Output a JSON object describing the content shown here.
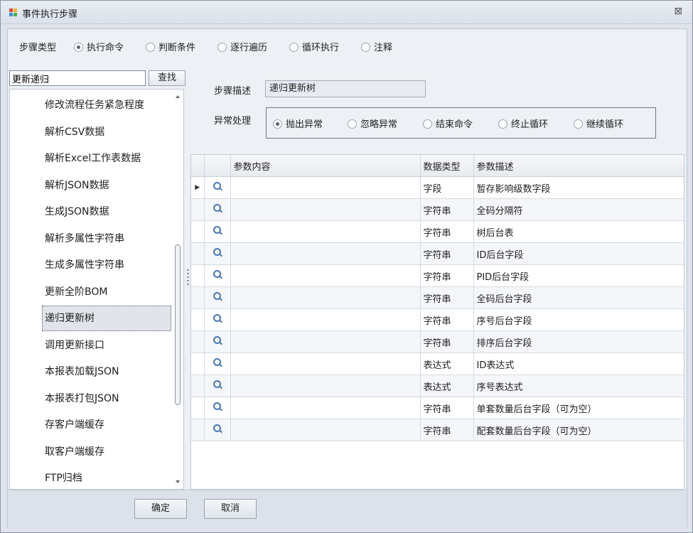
{
  "window": {
    "title": "事件执行步骤",
    "close_glyph": "⊠"
  },
  "step_type": {
    "label": "步骤类型",
    "options": [
      "执行命令",
      "判断条件",
      "逐行遍历",
      "循环执行",
      "注释"
    ],
    "selected": "执行命令"
  },
  "search": {
    "value": "更新递归",
    "button_label": "查找"
  },
  "commands": {
    "items": [
      "修改流程任务紧急程度",
      "解析CSV数据",
      "解析Excel工作表数据",
      "解析JSON数据",
      "生成JSON数据",
      "解析多属性字符串",
      "生成多属性字符串",
      "更新全阶BOM",
      "递归更新树",
      "调用更新接口",
      "本报表加载JSON",
      "本报表打包JSON",
      "存客户端缓存",
      "取客户端缓存",
      "FTP归档"
    ],
    "selected": "递归更新树"
  },
  "step_desc": {
    "label": "步骤描述",
    "value": "递归更新树"
  },
  "exception": {
    "label": "异常处理",
    "options": [
      "抛出异常",
      "忽略异常",
      "结束命令",
      "终止循环",
      "继续循环"
    ],
    "selected": "抛出异常"
  },
  "params_table": {
    "headers": [
      "参数内容",
      "数据类型",
      "参数描述"
    ],
    "current_row_glyph": "▶",
    "rows": [
      {
        "content": "",
        "type": "字段",
        "desc": "暂存影响级数字段"
      },
      {
        "content": "",
        "type": "字符串",
        "desc": "全码分隔符"
      },
      {
        "content": "",
        "type": "字符串",
        "desc": "树后台表"
      },
      {
        "content": "",
        "type": "字符串",
        "desc": "ID后台字段"
      },
      {
        "content": "",
        "type": "字符串",
        "desc": "PID后台字段"
      },
      {
        "content": "",
        "type": "字符串",
        "desc": "全码后台字段"
      },
      {
        "content": "",
        "type": "字符串",
        "desc": "序号后台字段"
      },
      {
        "content": "",
        "type": "字符串",
        "desc": "排序后台字段"
      },
      {
        "content": "",
        "type": "表达式",
        "desc": "ID表达式"
      },
      {
        "content": "",
        "type": "表达式",
        "desc": "序号表达式"
      },
      {
        "content": "",
        "type": "字符串",
        "desc": "单套数量后台字段（可为空）"
      },
      {
        "content": "",
        "type": "字符串",
        "desc": "配套数量后台字段（可为空）"
      }
    ]
  },
  "footer": {
    "ok_label": "确定",
    "cancel_label": "取消"
  },
  "icons": {
    "row_lookup": "magnifier-icon",
    "app": "app-window-icon"
  },
  "colors": {
    "window_bg": "#dfe4ec",
    "panel_bg": "#edf0f4",
    "lookup_icon": "#4b78b3",
    "selection_bg": "#e1e4ea"
  }
}
